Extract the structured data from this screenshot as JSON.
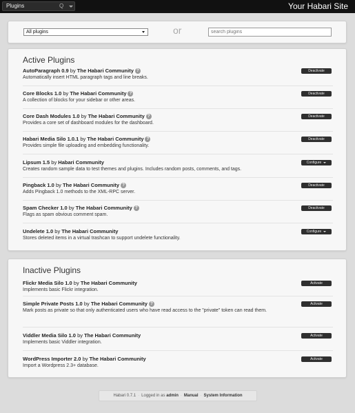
{
  "topbar": {
    "menu_label": "Plugins",
    "menu_shortcut": "Q",
    "site_title": "Your Habari Site"
  },
  "filter": {
    "selected": "All plugins",
    "or_label": "or",
    "search_placeholder": "search plugins"
  },
  "active": {
    "title": "Active Plugins",
    "plugins": [
      {
        "name": "AutoParagraph 0.9",
        "by": "by",
        "author": "The Habari Community",
        "has_help": true,
        "description": "Automatically insert HTML paragraph tags and line breaks.",
        "action": "Deactivate"
      },
      {
        "name": "Core Blocks 1.0",
        "by": "by",
        "author": "The Habari Community",
        "has_help": true,
        "description": "A collection of blocks for your sidebar or other areas.",
        "action": "Deactivate"
      },
      {
        "name": "Core Dash Modules 1.0",
        "by": "by",
        "author": "The Habari Community",
        "has_help": true,
        "description": "Provides a core set of dashboard modules for the dashboard.",
        "action": "Deactivate"
      },
      {
        "name": "Habari Media Silo 1.0.1",
        "by": "by",
        "author": "The Habari Community",
        "has_help": true,
        "description": "Provides simple file uploading and embedding functionality.",
        "action": "Deactivate"
      },
      {
        "name": "Lipsum 1.5",
        "by": "by",
        "author": "Habari Community",
        "has_help": false,
        "description": "Creates random sample data to test themes and plugins. Includes random posts, comments, and tags.",
        "action": "Configure"
      },
      {
        "name": "Pingback 1.0",
        "by": "by",
        "author": "The Habari Community",
        "has_help": true,
        "description": "Adds Pingback 1.0 methods to the XML-RPC server.",
        "action": "Deactivate"
      },
      {
        "name": "Spam Checker 1.0",
        "by": "by",
        "author": "The Habari Community",
        "has_help": true,
        "description": "Flags as spam obvious comment spam.",
        "action": "Deactivate"
      },
      {
        "name": "Undelete 1.0",
        "by": "by",
        "author": "The Habari Community",
        "has_help": false,
        "description": "Stores deleted items in a virtual trashcan to support undelete functionality.",
        "action": "Configure"
      }
    ]
  },
  "inactive": {
    "title": "Inactive Plugins",
    "plugins": [
      {
        "name": "Flickr Media Silo 1.0",
        "by": "by",
        "author": "The Habari Community",
        "has_help": false,
        "description": "Implements basic Flickr integration.",
        "action": "Activate"
      },
      {
        "name": "Simple Private Posts 1.0",
        "by": "by",
        "author": "The Habari Community",
        "has_help": true,
        "description": "Mark posts as private so that only authenticated users who have read access to the \"private\" token can read them.",
        "action": "Activate"
      },
      {
        "name": "Viddler Media Silo 1.0",
        "by": "by",
        "author": "The Habari Community",
        "has_help": false,
        "description": "Implements basic Viddler integration.",
        "action": "Activate"
      },
      {
        "name": "WordPress Importer 2.0",
        "by": "by",
        "author": "The Habari Community",
        "has_help": false,
        "description": "Import a Wordpress 2.3+ database.",
        "action": "Activate"
      }
    ]
  },
  "footer": {
    "version": "Habari 0.7.1",
    "logged_in_prefix": "Logged in as",
    "user": "admin",
    "manual": "Manual",
    "system_info": "System Information"
  }
}
